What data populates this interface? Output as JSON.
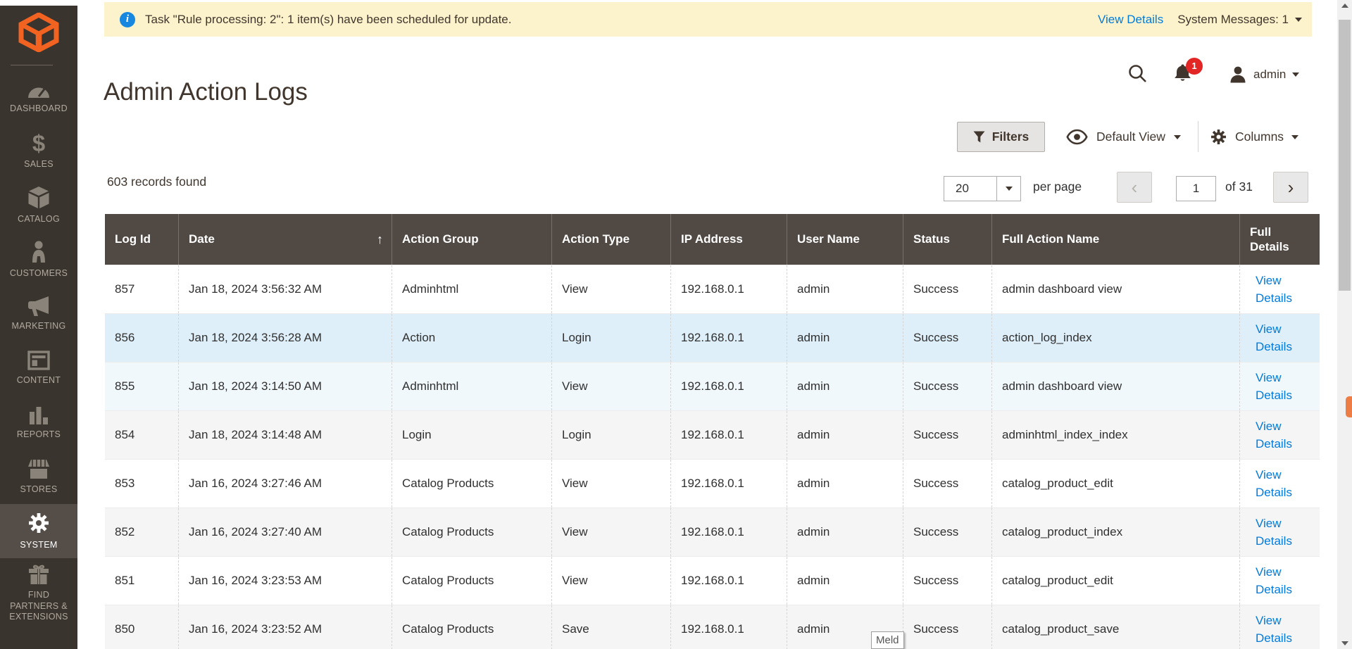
{
  "notification_bar": {
    "message": "Task \"Rule processing: 2\": 1 item(s) have been scheduled for update.",
    "view_details": "View Details",
    "system_messages": "System Messages: 1"
  },
  "sidebar": {
    "items": [
      {
        "label": "DASHBOARD",
        "icon": "dashboard-icon",
        "active": false
      },
      {
        "label": "SALES",
        "icon": "sales-icon",
        "active": false
      },
      {
        "label": "CATALOG",
        "icon": "catalog-icon",
        "active": false
      },
      {
        "label": "CUSTOMERS",
        "icon": "customers-icon",
        "active": false
      },
      {
        "label": "MARKETING",
        "icon": "marketing-icon",
        "active": false
      },
      {
        "label": "CONTENT",
        "icon": "content-icon",
        "active": false
      },
      {
        "label": "REPORTS",
        "icon": "reports-icon",
        "active": false
      },
      {
        "label": "STORES",
        "icon": "stores-icon",
        "active": false
      },
      {
        "label": "SYSTEM",
        "icon": "system-icon",
        "active": true
      },
      {
        "label": "FIND PARTNERS & EXTENSIONS",
        "icon": "find-partners-icon",
        "active": false
      }
    ]
  },
  "header": {
    "title": "Admin Action Logs",
    "user_name": "admin",
    "notification_count": "1"
  },
  "toolbar": {
    "filters": "Filters",
    "view": "Default View",
    "columns": "Columns"
  },
  "pager": {
    "records_found": "603 records found",
    "page_size": "20",
    "per_page": "per page",
    "prev": "‹",
    "next": "›",
    "current_page": "1",
    "total": "of 31"
  },
  "table": {
    "columns": [
      "Log Id",
      "Date",
      "Action Group",
      "Action Type",
      "IP Address",
      "User Name",
      "Status",
      "Full Action Name",
      "Full Details"
    ],
    "sort_column": "Date",
    "sort_arrow": "↑",
    "view_details_label": "View Details",
    "rows": [
      {
        "log_id": "857",
        "date": "Jan 18, 2024 3:56:32 AM",
        "action_group": "Adminhtml",
        "action_type": "View",
        "ip_address": "192.168.0.1",
        "user_name": "admin",
        "status": "Success",
        "full_action_name": "admin dashboard view",
        "highlight": "white"
      },
      {
        "log_id": "856",
        "date": "Jan 18, 2024 3:56:28 AM",
        "action_group": "Action",
        "action_type": "Login",
        "ip_address": "192.168.0.1",
        "user_name": "admin",
        "status": "Success",
        "full_action_name": "action_log_index",
        "highlight": "blue"
      },
      {
        "log_id": "855",
        "date": "Jan 18, 2024 3:14:50 AM",
        "action_group": "Adminhtml",
        "action_type": "View",
        "ip_address": "192.168.0.1",
        "user_name": "admin",
        "status": "Success",
        "full_action_name": "admin dashboard view",
        "highlight": "pale-blue"
      },
      {
        "log_id": "854",
        "date": "Jan 18, 2024 3:14:48 AM",
        "action_group": "Login",
        "action_type": "Login",
        "ip_address": "192.168.0.1",
        "user_name": "admin",
        "status": "Success",
        "full_action_name": "adminhtml_index_index",
        "highlight": "gray"
      },
      {
        "log_id": "853",
        "date": "Jan 16, 2024 3:27:46 AM",
        "action_group": "Catalog Products",
        "action_type": "View",
        "ip_address": "192.168.0.1",
        "user_name": "admin",
        "status": "Success",
        "full_action_name": "catalog_product_edit",
        "highlight": "white"
      },
      {
        "log_id": "852",
        "date": "Jan 16, 2024 3:27:40 AM",
        "action_group": "Catalog Products",
        "action_type": "View",
        "ip_address": "192.168.0.1",
        "user_name": "admin",
        "status": "Success",
        "full_action_name": "catalog_product_index",
        "highlight": "gray"
      },
      {
        "log_id": "851",
        "date": "Jan 16, 2024 3:23:53 AM",
        "action_group": "Catalog Products",
        "action_type": "View",
        "ip_address": "192.168.0.1",
        "user_name": "admin",
        "status": "Success",
        "full_action_name": "catalog_product_edit",
        "highlight": "white"
      },
      {
        "log_id": "850",
        "date": "Jan 16, 2024 3:23:52 AM",
        "action_group": "Catalog Products",
        "action_type": "Save",
        "ip_address": "192.168.0.1",
        "user_name": "admin",
        "status": "Success",
        "full_action_name": "catalog_product_save",
        "highlight": "gray"
      }
    ]
  },
  "tooltip": {
    "text": "Meld"
  },
  "colors": {
    "accent_orange": "#f26322",
    "table_header_bg": "#514943",
    "sidebar_bg": "#3a342e",
    "sidebar_active_bg": "#554e48",
    "link_blue": "#007bdb",
    "badge_red": "#e22626",
    "notification_yellow": "#fcf3cc",
    "row_gray": "#f5f5f5",
    "row_blue": "#deeff9",
    "row_pale_blue": "#f1f8fc",
    "scroll_marker_orange": "#ee7d45"
  }
}
